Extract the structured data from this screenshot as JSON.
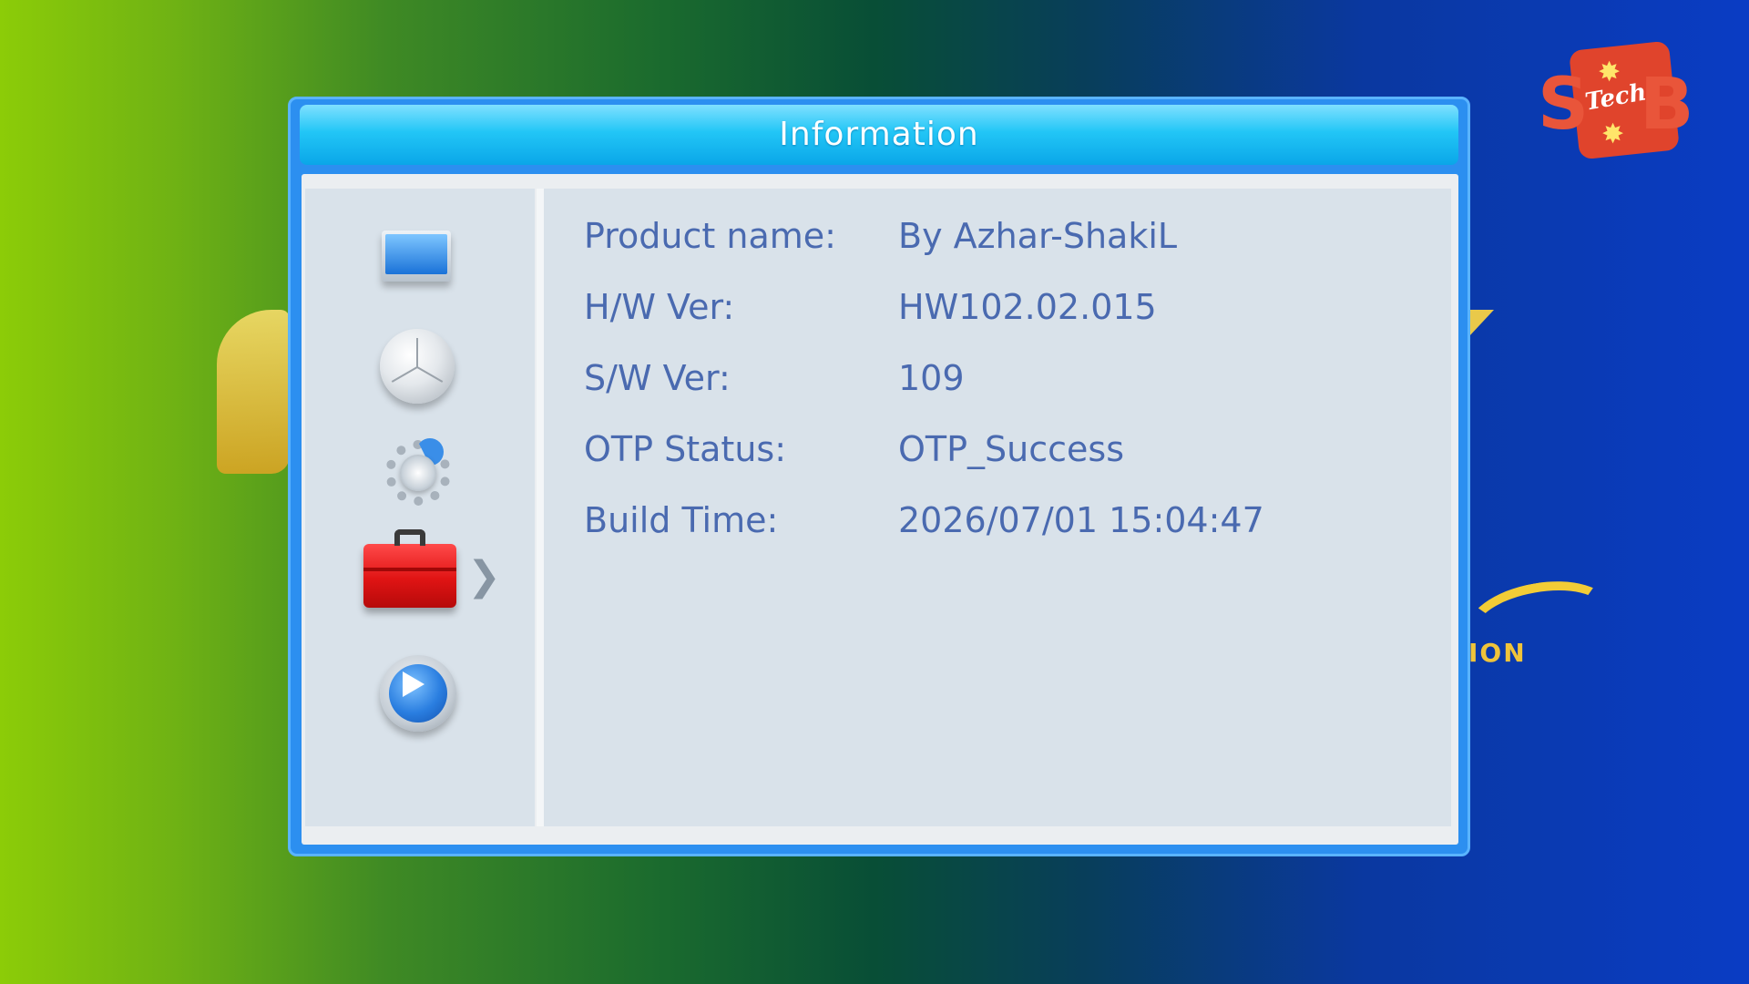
{
  "dialog": {
    "title": "Information"
  },
  "sidebar": {
    "items": [
      {
        "icon": "tv-icon",
        "selected": false
      },
      {
        "icon": "satellite-dish-icon",
        "selected": false
      },
      {
        "icon": "gear-icon",
        "selected": false
      },
      {
        "icon": "toolbox-icon",
        "selected": true
      },
      {
        "icon": "play-icon",
        "selected": false
      }
    ]
  },
  "info": {
    "rows": [
      {
        "label": "Product name:",
        "value": "By Azhar-ShakiL"
      },
      {
        "label": "H/W Ver:",
        "value": "HW102.02.015"
      },
      {
        "label": "S/W Ver:",
        "value": "109"
      },
      {
        "label": "OTP Status:",
        "value": "OTP_Success"
      },
      {
        "label": "Build Time:",
        "value": "2026/07/01 15:04:47"
      }
    ]
  },
  "logo": {
    "text": "Tech",
    "left_letter": "S",
    "right_letter": "B"
  },
  "background": {
    "partial_text": "ION"
  },
  "colors": {
    "title_bar": "#22c6f6",
    "dialog_frame": "#2c8ff0",
    "panel": "#d9e2ea",
    "text": "#4a6ab0",
    "selected_icon": "#e01414"
  }
}
